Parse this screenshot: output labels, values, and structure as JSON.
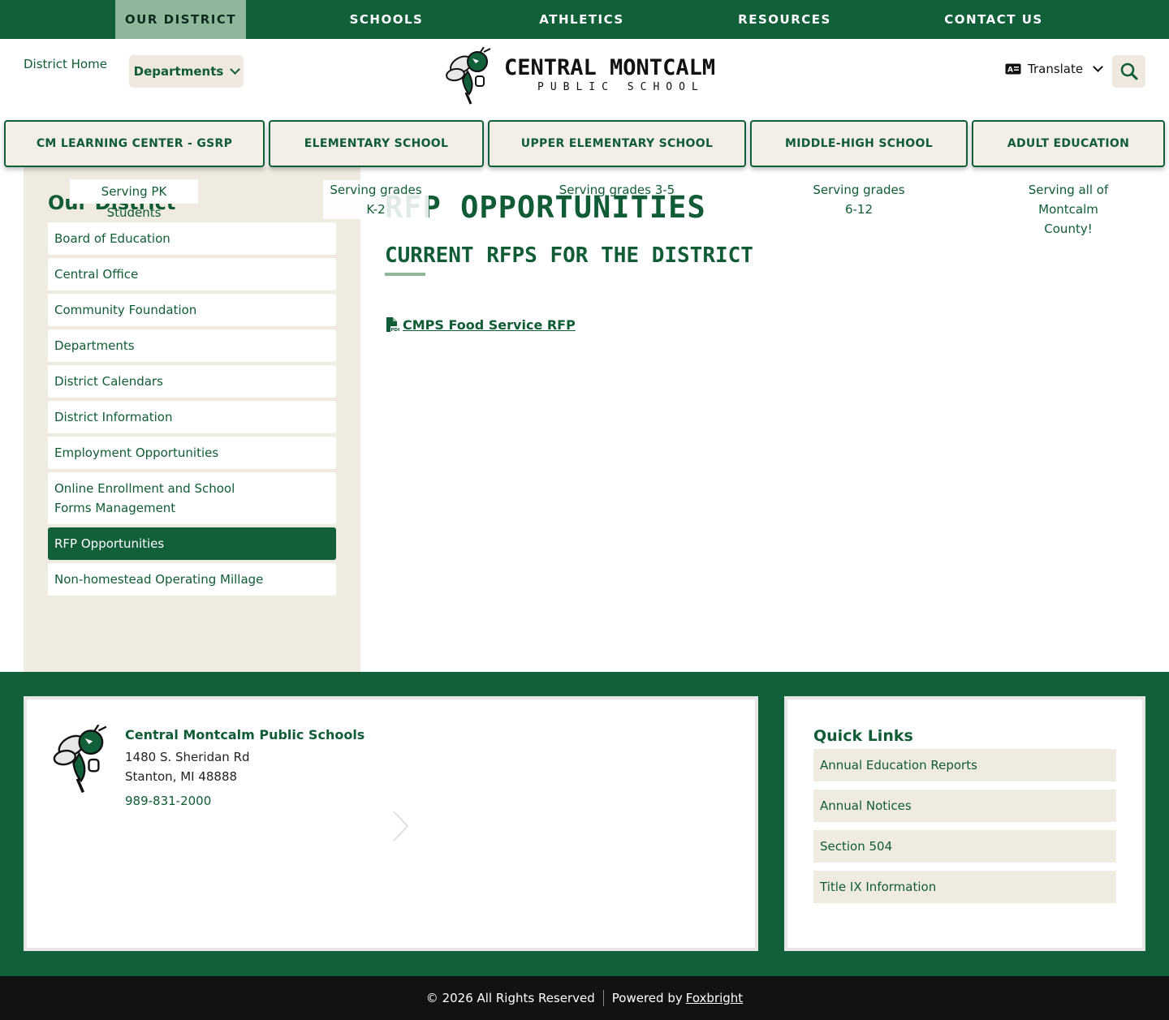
{
  "top_nav": [
    {
      "label": "OUR DISTRICT",
      "active": true
    },
    {
      "label": "SCHOOLS"
    },
    {
      "label": "ATHLETICS"
    },
    {
      "label": "RESOURCES"
    },
    {
      "label": "CONTACT US"
    }
  ],
  "header": {
    "district_home": "District Home",
    "departments_label": "Departments",
    "logo_line1": "CENTRAL MONTCALM",
    "logo_line2": "PUBLIC SCHOOL",
    "translate_label": "Translate"
  },
  "schools": [
    {
      "label": "CM LEARNING CENTER - GSRP",
      "note": "Serving PK Students"
    },
    {
      "label": "ELEMENTARY SCHOOL",
      "note_line1": "Serving grades",
      "note_line2": "K-2"
    },
    {
      "label": "UPPER ELEMENTARY SCHOOL",
      "note": "Serving grades 3-5"
    },
    {
      "label": "MIDDLE-HIGH SCHOOL",
      "note_line1": "Serving grades",
      "note_line2": "6-12"
    },
    {
      "label": "ADULT EDUCATION",
      "note_line1": "Serving all of",
      "note_line2": "Montcalm",
      "note_line3": "County!"
    }
  ],
  "sidebar": {
    "title": "Our District",
    "items": [
      {
        "label": "Board of Education"
      },
      {
        "label": "Central Office"
      },
      {
        "label": "Community Foundation"
      },
      {
        "label": "Departments"
      },
      {
        "label": "District Calendars"
      },
      {
        "label": "District Information"
      },
      {
        "label": "Employment Opportunities"
      },
      {
        "label_line1": "Online Enrollment and School",
        "label_line2": "Forms Management"
      },
      {
        "label": "RFP Opportunities",
        "active": true
      },
      {
        "label": "Non-homestead Operating Millage"
      }
    ]
  },
  "main": {
    "title": "RFP OPPORTUNITIES",
    "subtitle": "CURRENT RFPS FOR THE DISTRICT",
    "link_label": "CMPS Food Service RFP"
  },
  "footer": {
    "org_name": "Central Montcalm Public Schools",
    "address_line1": "1480 S. Sheridan Rd",
    "address_line2": "Stanton, MI 48888",
    "phone": "989-831-2000",
    "quick_links_title": "Quick Links",
    "quick_links": [
      {
        "label": "Annual Education Reports"
      },
      {
        "label": "Annual Notices"
      },
      {
        "label": "Section 504"
      },
      {
        "label": "Title IX Information"
      }
    ],
    "copyright": "© 2026 All Rights Reserved",
    "powered_by": "Powered by",
    "powered_by_link": "Foxbright"
  },
  "colors": {
    "brand_green": "#11603a",
    "accent_green": "#8fb79c",
    "beige": "#f0ebe1"
  },
  "icons": [
    "chevron-down-icon",
    "translate-icon",
    "search-icon",
    "pdf-file-icon",
    "hornet-mascot-icon",
    "chevron-right-icon"
  ]
}
